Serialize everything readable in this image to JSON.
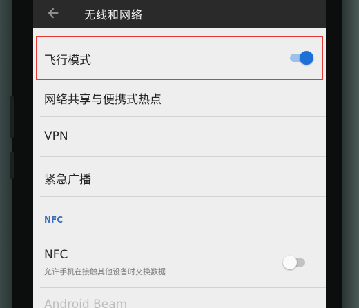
{
  "app_bar": {
    "title": "无线和网络",
    "back_icon": "arrow-left-icon"
  },
  "settings": {
    "airplane_mode": {
      "label": "飞行模式",
      "enabled": true
    },
    "tethering": {
      "label": "网络共享与便携式热点"
    },
    "vpn": {
      "label": "VPN"
    },
    "emergency_broadcast": {
      "label": "紧急广播"
    },
    "nfc_section": {
      "header": "NFC"
    },
    "nfc": {
      "label": "NFC",
      "description": "允许手机在接触其他设备时交换数据",
      "enabled": false
    },
    "android_beam": {
      "label": "Android Beam"
    }
  },
  "colors": {
    "toggle_on": "#1f6fd8",
    "highlight_border": "#e53935",
    "section_header": "#3f6fb8",
    "app_bar": "#2a2a2a"
  }
}
